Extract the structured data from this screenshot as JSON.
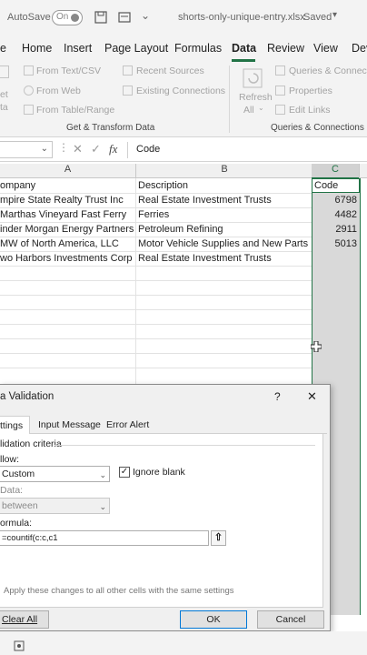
{
  "titlebar": {
    "autosave_label": "AutoSave",
    "toggle_state": "On",
    "filename": "shorts-only-unique-entry.xlsx",
    "save_state": "Saved"
  },
  "tabs": [
    "e",
    "Home",
    "Insert",
    "Page Layout",
    "Formulas",
    "Data",
    "Review",
    "View",
    "Dev"
  ],
  "active_tab": "Data",
  "ribbon": {
    "get_data_partial": "et",
    "get_data_partial2": "ta",
    "from_text_csv": "From Text/CSV",
    "from_web": "From Web",
    "from_table_range": "From Table/Range",
    "recent_sources": "Recent Sources",
    "existing_connections": "Existing Connections",
    "group_get_transform": "Get & Transform Data",
    "refresh": "Refresh",
    "refresh_all": "All",
    "queries_connections": "Queries & Connecti",
    "properties": "Properties",
    "edit_links": "Edit Links",
    "group_queries": "Queries & Connections"
  },
  "formula_bar": {
    "fx": "fx",
    "content": "Code"
  },
  "columns": [
    "A",
    "B",
    "C"
  ],
  "table": {
    "headers": {
      "company": "ompany",
      "description": "Description",
      "code": "Code"
    },
    "rows": [
      {
        "company": "mpire State Realty Trust Inc",
        "description": "Real Estate Investment Trusts",
        "code": "6798"
      },
      {
        "company": "Marthas Vineyard Fast Ferry",
        "description": "Ferries",
        "code": "4482"
      },
      {
        "company": "inder Morgan Energy Partners",
        "description": "Petroleum Refining",
        "code": "2911"
      },
      {
        "company": "MW of North America, LLC",
        "description": "Motor Vehicle Supplies and New Parts",
        "code": "5013"
      },
      {
        "company": "wo Harbors Investments Corp",
        "description": "Real Estate Investment Trusts",
        "code": ""
      }
    ]
  },
  "dialog": {
    "title": "a Validation",
    "help": "?",
    "close": "✕",
    "tabs": [
      "ttings",
      "Input Message",
      "Error Alert"
    ],
    "criteria_label": "lidation criteria",
    "allow_label": "llow:",
    "allow_value": "Custom",
    "ignore_blank_label": "Ignore blank",
    "data_label": "Data:",
    "data_value": "between",
    "formula_label": "ormula:",
    "formula_value": "=countif(c:c,c1",
    "apply_text": "Apply these changes to all other cells with the same settings",
    "clear_all": "Clear All",
    "ok": "OK",
    "cancel": "Cancel"
  }
}
